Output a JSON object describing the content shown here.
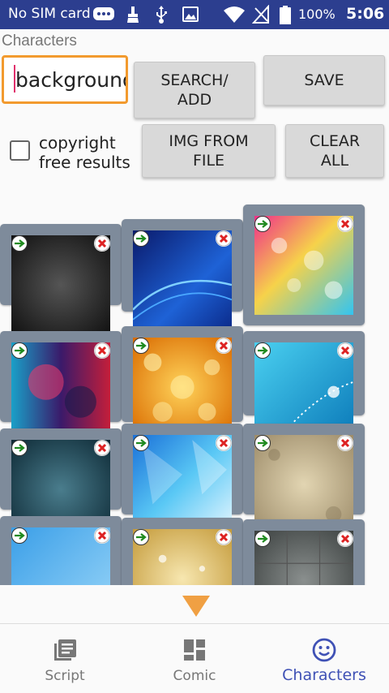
{
  "status_bar": {
    "carrier": "No SIM card",
    "battery": "100%",
    "time": "5:06"
  },
  "section_title": "Characters",
  "search": {
    "value": "background"
  },
  "buttons": {
    "search_add": "SEARCH/\nADD",
    "save": "SAVE",
    "img_from_file": "IMG FROM\nFILE",
    "clear_all": "CLEAR\nALL"
  },
  "copyright_checkbox": {
    "label": "copyright\nfree results",
    "checked": false
  },
  "results": [
    {
      "name": "dark-texture"
    },
    {
      "name": "blue-waves"
    },
    {
      "name": "pink-bokeh"
    },
    {
      "name": "nebula"
    },
    {
      "name": "orange-bokeh"
    },
    {
      "name": "blue-sparkle"
    },
    {
      "name": "teal-grunge"
    },
    {
      "name": "blue-geometric"
    },
    {
      "name": "beige-grunge"
    },
    {
      "name": "light-blue-texture"
    },
    {
      "name": "gold-glitter"
    },
    {
      "name": "gray-tiles"
    }
  ],
  "bottom_nav": [
    {
      "label": "Script",
      "icon": "script-icon",
      "active": false
    },
    {
      "label": "Comic",
      "icon": "comic-grid-icon",
      "active": false
    },
    {
      "label": "Characters",
      "icon": "smiley-icon",
      "active": true
    }
  ],
  "colors": {
    "status_bar": "#2c3e8f",
    "accent": "#3f51b5",
    "input_border": "#f29a2e",
    "tile_frame": "#7e8b9b",
    "scroll_arrow": "#f0a043"
  }
}
